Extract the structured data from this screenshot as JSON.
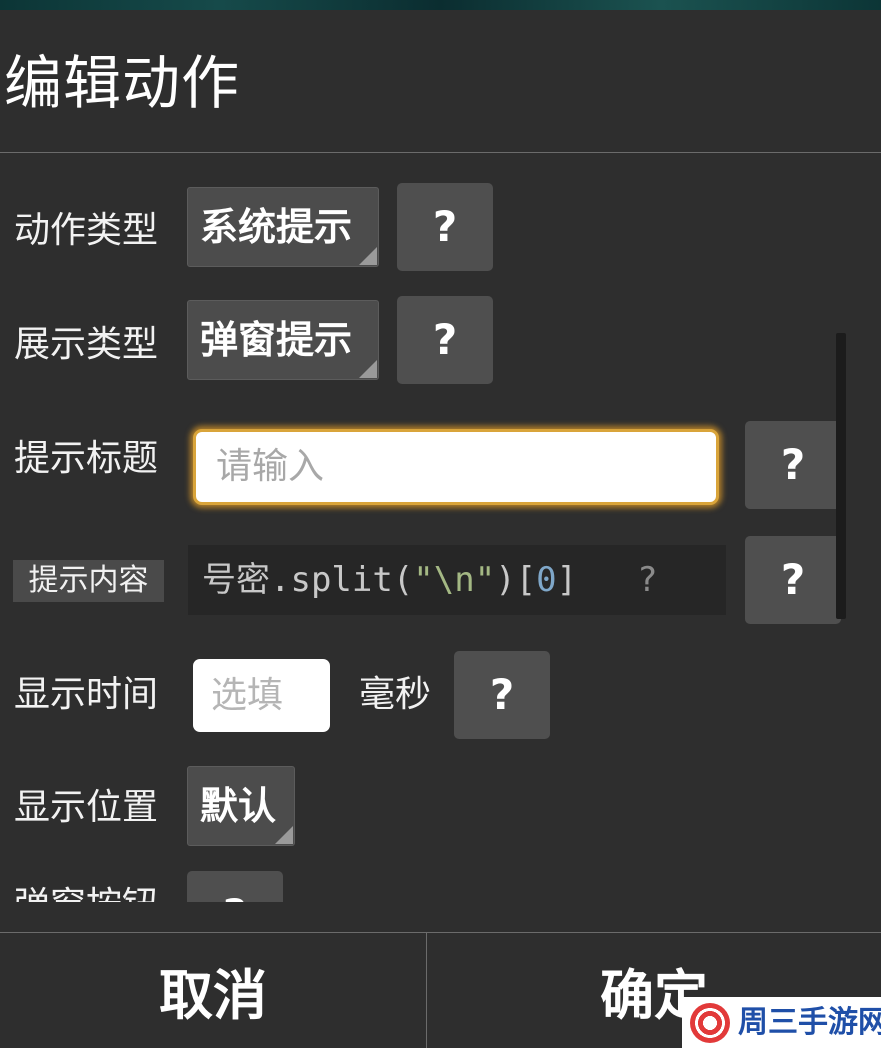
{
  "dialog": {
    "title": "编辑动作",
    "help_label": "?"
  },
  "fields": {
    "action_type": {
      "label": "动作类型",
      "value": "系统提示"
    },
    "display_type": {
      "label": "展示类型",
      "value": "弹窗提示"
    },
    "prompt_title": {
      "label": "提示标题",
      "placeholder": "请输入"
    },
    "prompt_content": {
      "label": "提示内容",
      "code_parts": [
        "号密.split(",
        "\"\\n\"",
        ")[",
        "0",
        "]"
      ],
      "inline_help": "?"
    },
    "display_time": {
      "label": "显示时间",
      "placeholder": "选填",
      "unit": "毫秒"
    },
    "display_position": {
      "label": "显示位置",
      "value": "默认"
    },
    "popup_buttons": {
      "label": "弹窗按钮"
    }
  },
  "footer": {
    "cancel_label": "取消",
    "confirm_label": "确定"
  },
  "watermark": {
    "text": "周三手游网"
  },
  "colors": {
    "dialog_bg": "#2e2e2e",
    "button_bg": "#4f4f4f",
    "focus_glow": "#d9a43a",
    "code_string": "#a4b884",
    "code_number": "#7fa7c9",
    "watermark_text": "#1f4fa8"
  }
}
